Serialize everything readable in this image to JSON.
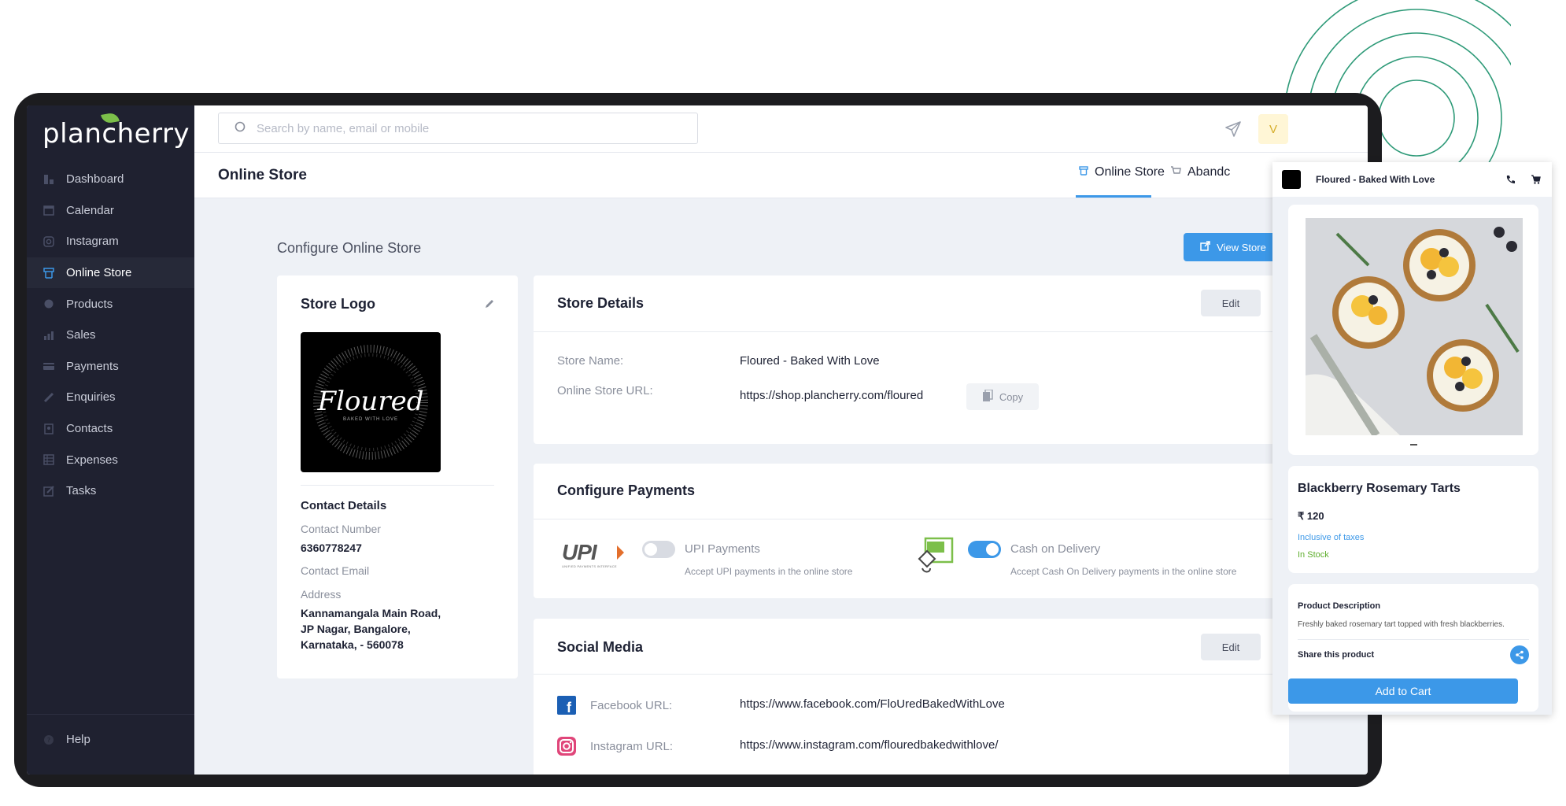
{
  "app": {
    "brand": "plancherry",
    "accent": "#3c98e8",
    "sidebar_bg": "#1f2130"
  },
  "search": {
    "placeholder": "Search by name, email or mobile"
  },
  "user": {
    "initial": "V"
  },
  "sidebar": {
    "items": [
      {
        "label": "Dashboard",
        "icon": "dashboard-icon"
      },
      {
        "label": "Calendar",
        "icon": "calendar-icon"
      },
      {
        "label": "Instagram",
        "icon": "instagram-icon"
      },
      {
        "label": "Online Store",
        "icon": "store-icon",
        "active": true
      },
      {
        "label": "Products",
        "icon": "products-icon"
      },
      {
        "label": "Sales",
        "icon": "sales-icon"
      },
      {
        "label": "Payments",
        "icon": "payments-icon"
      },
      {
        "label": "Enquiries",
        "icon": "enquiries-icon"
      },
      {
        "label": "Contacts",
        "icon": "contacts-icon"
      },
      {
        "label": "Expenses",
        "icon": "expenses-icon"
      },
      {
        "label": "Tasks",
        "icon": "tasks-icon"
      }
    ],
    "help": "Help"
  },
  "header": {
    "title": "Online Store",
    "tabs": [
      {
        "label": "Online Store",
        "active": true
      },
      {
        "label": "Abandc"
      }
    ]
  },
  "main": {
    "section_title": "Configure Online Store",
    "view_store": "View Store",
    "logo_card": {
      "title": "Store Logo",
      "logo_text": "Floured",
      "logo_subtext": "BAKED WITH LOVE",
      "contact_title": "Contact Details",
      "contact_number_label": "Contact Number",
      "contact_number": "6360778247",
      "contact_email_label": "Contact Email",
      "address_label": "Address",
      "address_lines": [
        "Kannamangala Main Road,",
        "JP Nagar, Bangalore,",
        "Karnataka, - 560078"
      ]
    },
    "store_details": {
      "title": "Store Details",
      "edit": "Edit",
      "name_label": "Store Name:",
      "name_value": "Floured - Baked With Love",
      "url_label": "Online Store URL:",
      "url_value": "https://shop.plancherry.com/floured",
      "copy": "Copy"
    },
    "payments": {
      "title": "Configure Payments",
      "upi": {
        "logo": "UPI",
        "logo_sub": "UNIFIED PAYMENTS INTERFACE",
        "label": "UPI Payments",
        "desc": "Accept UPI payments in the online store",
        "enabled": false
      },
      "cod": {
        "label": "Cash on Delivery",
        "desc": "Accept Cash On Delivery payments in the online store",
        "enabled": true
      }
    },
    "social": {
      "title": "Social Media",
      "edit": "Edit",
      "facebook_label": "Facebook URL:",
      "facebook_value": "https://www.facebook.com/FloUredBakedWithLove",
      "instagram_label": "Instagram URL:",
      "instagram_value": "https://www.instagram.com/flouredbakedwithlove/"
    }
  },
  "preview": {
    "store_name": "Floured - Baked With Love",
    "product_name": "Blackberry Rosemary Tarts",
    "price": "₹ 120",
    "taxes": "Inclusive of taxes",
    "stock": "In Stock",
    "desc_title": "Product Description",
    "desc": "Freshly baked rosemary tart topped with fresh blackberries.",
    "share": "Share this product",
    "add_to_cart": "Add to Cart"
  }
}
